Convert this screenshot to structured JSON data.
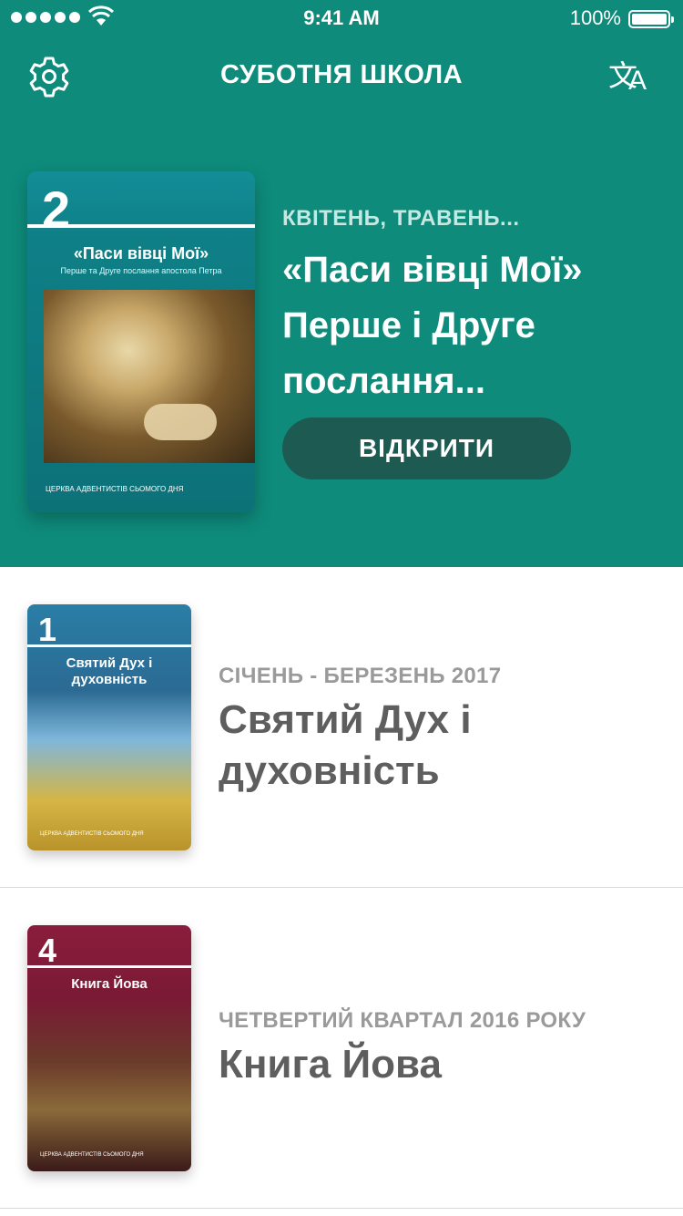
{
  "status_bar": {
    "time": "9:41 AM",
    "battery": "100%"
  },
  "header": {
    "title": "СУБОТНЯ ШКОЛА",
    "translate_glyph_1": "文",
    "translate_glyph_2": "A"
  },
  "featured": {
    "cover": {
      "quarter_number": "2",
      "title": "«Паси вівці Мої»",
      "subtitle": "Перше та Друге послання апостола Петра",
      "footer": "ЦЕРКВА АДВЕНТИСТІВ СЬОМОГО ДНЯ"
    },
    "period": "КВІТЕНЬ, ТРАВЕНЬ...",
    "title": "«Паси вівці Мої» Перше і Друге послання...",
    "open_button": "ВІДКРИТИ"
  },
  "quarterlies": [
    {
      "cover_number": "1",
      "cover_title": "Святий Дух і духовність",
      "cover_footer": "ЦЕРКВА АДВЕНТИСТІВ СЬОМОГО ДНЯ",
      "period": "СІЧЕНЬ - БЕРЕЗЕНЬ 2017",
      "title": "Святий Дух і духовність"
    },
    {
      "cover_number": "4",
      "cover_title": "Книга Йова",
      "cover_footer": "ЦЕРКВА АДВЕНТИСТІВ СЬОМОГО ДНЯ",
      "period": "ЧЕТВЕРТИЙ КВАРТАЛ 2016 РОКУ",
      "title": "Книга Йова"
    }
  ],
  "colors": {
    "primary": "#0e8b7b",
    "button": "#1d5a52",
    "subtitle_light": "#c5e8e2",
    "row_title": "#5e5e5e",
    "row_sub": "#9a9a9a"
  }
}
